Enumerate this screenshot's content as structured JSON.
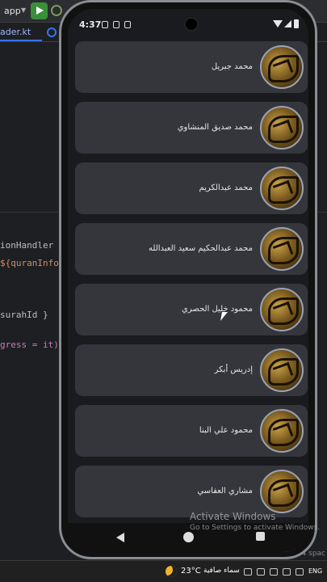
{
  "ide": {
    "run_config": "app",
    "tab_file": "ader.kt",
    "code_lines": [
      {
        "text": "ionHandler {"
      },
      {
        "text": "${quranInfo."
      },
      {
        "text": "surahId }"
      },
      {
        "text": "gress = it)"
      }
    ],
    "bottom_hint": "4 spac"
  },
  "phone": {
    "status": {
      "time": "4:37"
    },
    "reciters": [
      {
        "name": "محمد جبريل"
      },
      {
        "name": "محمد صديق المنشاوي"
      },
      {
        "name": "محمد عبدالكريم"
      },
      {
        "name": "محمد عبدالحكيم سعيد العبدالله"
      },
      {
        "name": "محمود خليل الحصري"
      },
      {
        "name": "إدريس أبكر"
      },
      {
        "name": "محمود علي البنا"
      },
      {
        "name": "مشاري العفاسي"
      }
    ]
  },
  "watermark": {
    "title": "Activate Windows",
    "subtitle": "Go to Settings to activate Windows."
  },
  "taskbar": {
    "temperature": "23°C",
    "weather": "سماء صافية",
    "language": "ENG"
  }
}
